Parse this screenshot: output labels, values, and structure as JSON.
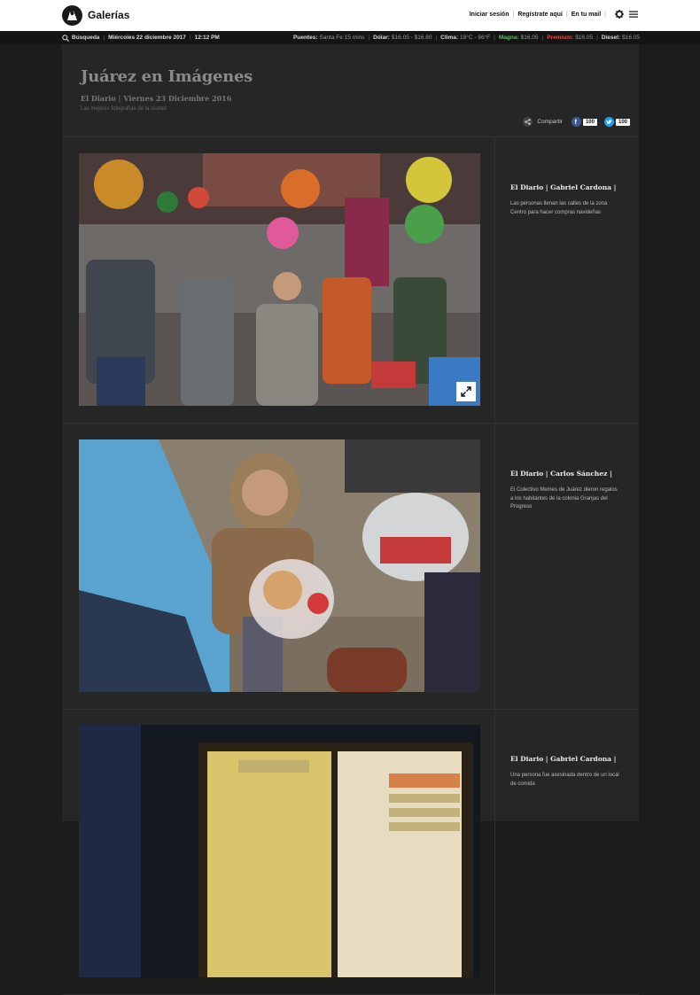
{
  "header": {
    "site_title": "Galerías",
    "links": [
      "Iniciar sesión",
      "Regístrate aquí",
      "En tu mail"
    ]
  },
  "ticker": {
    "search_label": "Búsqueda",
    "date": "Miércoles 22 diciembre 2017",
    "time": "12:12 PM",
    "items": [
      {
        "label": "Puentes:",
        "value": "Santa Fe 15 mins",
        "color": "#dddddd"
      },
      {
        "label": "Dólar:",
        "value": "$16.05 - $16.80",
        "color": "#dddddd"
      },
      {
        "label": "Clima:",
        "value": "18°C - 66°F",
        "color": "#dddddd"
      },
      {
        "label": "Magna:",
        "value": "$16.05",
        "color": "#5cb85c"
      },
      {
        "label": "Premium:",
        "value": "$16.05",
        "color": "#e04848"
      },
      {
        "label": "Diesel:",
        "value": "$16.05",
        "color": "#dddddd"
      }
    ]
  },
  "page": {
    "title": "Juárez en Imágenes",
    "source": "El Diario",
    "date": "Viernes 23 Diciembre 2016",
    "subtitle": "Las mejores fotografías de la ciudad"
  },
  "share": {
    "label": "Compartir",
    "facebook_count": "100",
    "twitter_count": "100"
  },
  "gallery": [
    {
      "author": "El Diario | Gabriel Cardona |",
      "caption": "Las personas llenan las calles de la zona Centro para hacer compras navideñas"
    },
    {
      "author": "El Diario | Carlos Sánchez |",
      "caption": "El Colectivo Memes de Juárez dieron regalos a los habitantes de la colonia Granjas del Progreso"
    },
    {
      "author": "El Diario | Gabriel Cardona |",
      "caption": "Una persona fue asesinada dentro de un local de comida"
    }
  ]
}
